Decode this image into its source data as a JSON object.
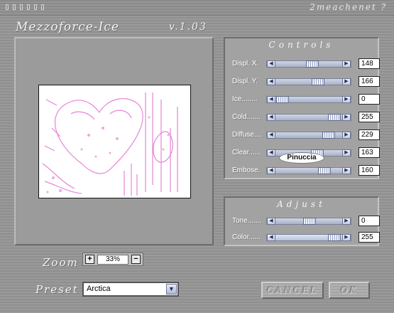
{
  "window": {
    "brand": "2meachenet ?",
    "title": "Mezzoforce-Ice",
    "version": "v.1.03"
  },
  "controls": {
    "title": "Controls",
    "rows": [
      {
        "label": "Displ. X.",
        "value": "148",
        "level": 0.58
      },
      {
        "label": "Displ. Y.",
        "value": "166",
        "level": 0.65
      },
      {
        "label": "Ice........",
        "value": "0",
        "level": 0.0
      },
      {
        "label": "Cold.......",
        "value": "255",
        "level": 1.0
      },
      {
        "label": "Diffuse....",
        "value": "229",
        "level": 0.9
      },
      {
        "label": "Clear......",
        "value": "163",
        "level": 0.64
      },
      {
        "label": "Embose.",
        "value": "160",
        "level": 0.63
      }
    ]
  },
  "adjust": {
    "title": "Adjust",
    "rows": [
      {
        "label": "Tone.......",
        "value": "0",
        "level": 0.5
      },
      {
        "label": "Color......",
        "value": "255",
        "level": 1.0
      }
    ]
  },
  "watermark": "Pinuccia",
  "zoom": {
    "label": "Zoom",
    "value": "33%",
    "plus": "+",
    "minus": "−"
  },
  "preset": {
    "label": "Preset",
    "value": "Arctica"
  },
  "buttons": {
    "cancel": "CANCEL",
    "ok": "OK"
  },
  "colors": {
    "preview_ink": "#e070d0",
    "panel_bg": "#a2a2a2",
    "slider_fill": "#b7c3db"
  }
}
